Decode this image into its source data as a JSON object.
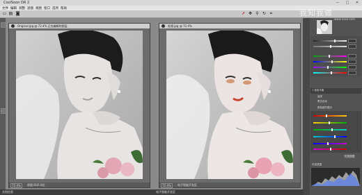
{
  "app": {
    "title": "CoolSoon DR 2"
  },
  "window_controls": {
    "minimize": "—",
    "maximize": "□",
    "close": "✕"
  },
  "menu": {
    "items": [
      "文件",
      "编辑",
      "调整",
      "滤镜",
      "视图",
      "窗口",
      "选项",
      "帮助"
    ]
  },
  "docs": [
    {
      "title": "Original.jpg @ 72.4% 正在编辑的图层",
      "zoom": "72.4%",
      "status": "原图 BGR 8位"
    },
    {
      "title": "处理.jpg @ 72.4%",
      "zoom": "72.4%",
      "status": "电子智能开发区"
    }
  ],
  "statusbar": {
    "left": "文档信息",
    "mid": "电子智能开发区"
  },
  "watermark": {
    "text": "我知我做",
    "sub": "www.xxxx.com"
  },
  "panel": {
    "section1": "1 色彩平衡",
    "option1": "高亮",
    "option2": "黑白自动",
    "option3": "颜色细节图示",
    "adjust": "调整",
    "bottom_label": "可选范围",
    "apply": "可选范围"
  },
  "colors": {
    "accent": "#f0c36b",
    "panel": "#535353"
  }
}
